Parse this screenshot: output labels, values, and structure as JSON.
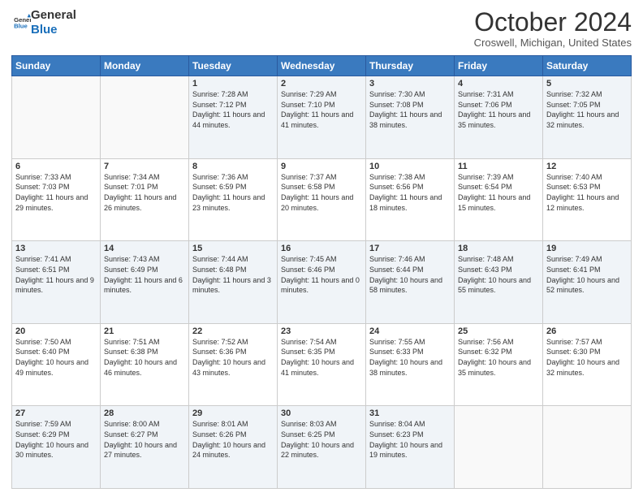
{
  "logo": {
    "line1": "General",
    "line2": "Blue"
  },
  "title": "October 2024",
  "subtitle": "Croswell, Michigan, United States",
  "weekdays": [
    "Sunday",
    "Monday",
    "Tuesday",
    "Wednesday",
    "Thursday",
    "Friday",
    "Saturday"
  ],
  "weeks": [
    [
      {
        "day": "",
        "info": ""
      },
      {
        "day": "",
        "info": ""
      },
      {
        "day": "1",
        "info": "Sunrise: 7:28 AM\nSunset: 7:12 PM\nDaylight: 11 hours and 44 minutes."
      },
      {
        "day": "2",
        "info": "Sunrise: 7:29 AM\nSunset: 7:10 PM\nDaylight: 11 hours and 41 minutes."
      },
      {
        "day": "3",
        "info": "Sunrise: 7:30 AM\nSunset: 7:08 PM\nDaylight: 11 hours and 38 minutes."
      },
      {
        "day": "4",
        "info": "Sunrise: 7:31 AM\nSunset: 7:06 PM\nDaylight: 11 hours and 35 minutes."
      },
      {
        "day": "5",
        "info": "Sunrise: 7:32 AM\nSunset: 7:05 PM\nDaylight: 11 hours and 32 minutes."
      }
    ],
    [
      {
        "day": "6",
        "info": "Sunrise: 7:33 AM\nSunset: 7:03 PM\nDaylight: 11 hours and 29 minutes."
      },
      {
        "day": "7",
        "info": "Sunrise: 7:34 AM\nSunset: 7:01 PM\nDaylight: 11 hours and 26 minutes."
      },
      {
        "day": "8",
        "info": "Sunrise: 7:36 AM\nSunset: 6:59 PM\nDaylight: 11 hours and 23 minutes."
      },
      {
        "day": "9",
        "info": "Sunrise: 7:37 AM\nSunset: 6:58 PM\nDaylight: 11 hours and 20 minutes."
      },
      {
        "day": "10",
        "info": "Sunrise: 7:38 AM\nSunset: 6:56 PM\nDaylight: 11 hours and 18 minutes."
      },
      {
        "day": "11",
        "info": "Sunrise: 7:39 AM\nSunset: 6:54 PM\nDaylight: 11 hours and 15 minutes."
      },
      {
        "day": "12",
        "info": "Sunrise: 7:40 AM\nSunset: 6:53 PM\nDaylight: 11 hours and 12 minutes."
      }
    ],
    [
      {
        "day": "13",
        "info": "Sunrise: 7:41 AM\nSunset: 6:51 PM\nDaylight: 11 hours and 9 minutes."
      },
      {
        "day": "14",
        "info": "Sunrise: 7:43 AM\nSunset: 6:49 PM\nDaylight: 11 hours and 6 minutes."
      },
      {
        "day": "15",
        "info": "Sunrise: 7:44 AM\nSunset: 6:48 PM\nDaylight: 11 hours and 3 minutes."
      },
      {
        "day": "16",
        "info": "Sunrise: 7:45 AM\nSunset: 6:46 PM\nDaylight: 11 hours and 0 minutes."
      },
      {
        "day": "17",
        "info": "Sunrise: 7:46 AM\nSunset: 6:44 PM\nDaylight: 10 hours and 58 minutes."
      },
      {
        "day": "18",
        "info": "Sunrise: 7:48 AM\nSunset: 6:43 PM\nDaylight: 10 hours and 55 minutes."
      },
      {
        "day": "19",
        "info": "Sunrise: 7:49 AM\nSunset: 6:41 PM\nDaylight: 10 hours and 52 minutes."
      }
    ],
    [
      {
        "day": "20",
        "info": "Sunrise: 7:50 AM\nSunset: 6:40 PM\nDaylight: 10 hours and 49 minutes."
      },
      {
        "day": "21",
        "info": "Sunrise: 7:51 AM\nSunset: 6:38 PM\nDaylight: 10 hours and 46 minutes."
      },
      {
        "day": "22",
        "info": "Sunrise: 7:52 AM\nSunset: 6:36 PM\nDaylight: 10 hours and 43 minutes."
      },
      {
        "day": "23",
        "info": "Sunrise: 7:54 AM\nSunset: 6:35 PM\nDaylight: 10 hours and 41 minutes."
      },
      {
        "day": "24",
        "info": "Sunrise: 7:55 AM\nSunset: 6:33 PM\nDaylight: 10 hours and 38 minutes."
      },
      {
        "day": "25",
        "info": "Sunrise: 7:56 AM\nSunset: 6:32 PM\nDaylight: 10 hours and 35 minutes."
      },
      {
        "day": "26",
        "info": "Sunrise: 7:57 AM\nSunset: 6:30 PM\nDaylight: 10 hours and 32 minutes."
      }
    ],
    [
      {
        "day": "27",
        "info": "Sunrise: 7:59 AM\nSunset: 6:29 PM\nDaylight: 10 hours and 30 minutes."
      },
      {
        "day": "28",
        "info": "Sunrise: 8:00 AM\nSunset: 6:27 PM\nDaylight: 10 hours and 27 minutes."
      },
      {
        "day": "29",
        "info": "Sunrise: 8:01 AM\nSunset: 6:26 PM\nDaylight: 10 hours and 24 minutes."
      },
      {
        "day": "30",
        "info": "Sunrise: 8:03 AM\nSunset: 6:25 PM\nDaylight: 10 hours and 22 minutes."
      },
      {
        "day": "31",
        "info": "Sunrise: 8:04 AM\nSunset: 6:23 PM\nDaylight: 10 hours and 19 minutes."
      },
      {
        "day": "",
        "info": ""
      },
      {
        "day": "",
        "info": ""
      }
    ]
  ]
}
